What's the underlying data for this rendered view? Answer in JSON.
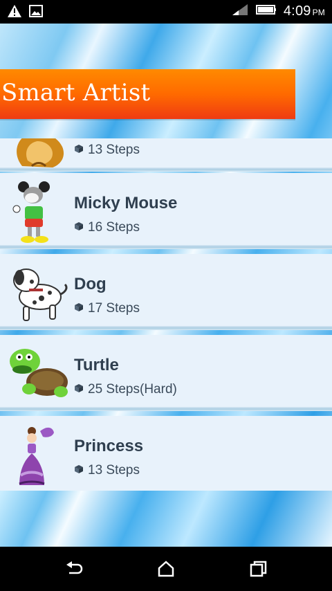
{
  "status_bar": {
    "time": "4:09",
    "ampm": "PM",
    "icons": [
      "warning-icon",
      "image-icon",
      "signal-icon",
      "battery-icon"
    ]
  },
  "app": {
    "title": "Smart Artist",
    "colors": {
      "banner_top": "#ff8a00",
      "banner_bottom": "#ef3b12",
      "row_bg": "#e8f2fb",
      "title_text": "#2f3f4f"
    }
  },
  "items": [
    {
      "title": "",
      "meta": "13 Steps",
      "thumb_icon": "lion-icon"
    },
    {
      "title": "Micky Mouse",
      "meta": "16 Steps",
      "thumb_icon": "micky-mouse-icon"
    },
    {
      "title": "Dog",
      "meta": "17 Steps",
      "thumb_icon": "dog-icon"
    },
    {
      "title": "Turtle",
      "meta": "25 Steps(Hard)",
      "thumb_icon": "turtle-icon"
    },
    {
      "title": "Princess",
      "meta": "13 Steps",
      "thumb_icon": "princess-icon"
    }
  ],
  "nav": {
    "icons": [
      "back-icon",
      "home-icon",
      "recents-icon"
    ]
  }
}
